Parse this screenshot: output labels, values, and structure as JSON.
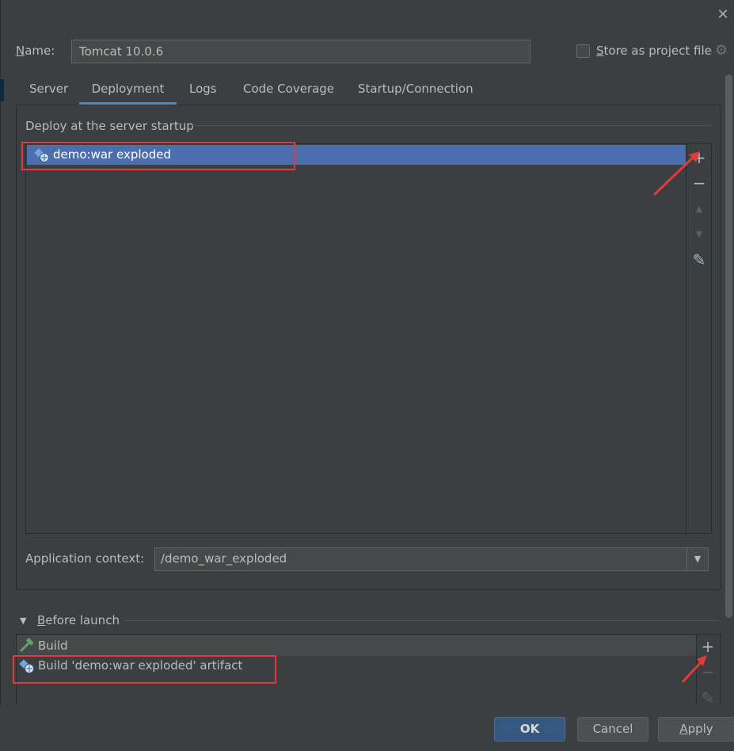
{
  "header": {
    "name_label_mnemonic": "N",
    "name_label_rest": "ame:",
    "name_value": "Tomcat 10.0.6",
    "store_label_mnemonic": "S",
    "store_label_rest": "tore as project file",
    "store_checked": false
  },
  "tabs": [
    {
      "label": "Server"
    },
    {
      "label": "Deployment",
      "active": true
    },
    {
      "label": "Logs"
    },
    {
      "label": "Code Coverage"
    },
    {
      "label": "Startup/Connection"
    }
  ],
  "deployment": {
    "section_title": "Deploy at the server startup",
    "artifacts": [
      {
        "label": "demo:war exploded",
        "icon": "war-artifact-icon",
        "selected": true
      }
    ],
    "toolbar": {
      "add": "+",
      "remove": "−",
      "up": "▲",
      "down": "▼",
      "edit": "✎"
    },
    "context_label": "Application context:",
    "context_value": "/demo_war_exploded"
  },
  "before_launch": {
    "title_mnemonic": "B",
    "title_rest": "efore launch",
    "items": [
      {
        "label": "Build",
        "icon": "hammer-icon"
      },
      {
        "label": "Build 'demo:war exploded' artifact",
        "icon": "war-artifact-icon"
      }
    ],
    "toolbar": {
      "add": "+",
      "remove": "−",
      "edit": "✎"
    }
  },
  "buttons": {
    "ok": "OK",
    "cancel": "Cancel",
    "apply_mnemonic": "A",
    "apply_rest": "pply"
  },
  "colors": {
    "background": "#3c3f41",
    "selection": "#4b6eaf",
    "annotation_red": "#e03c3c",
    "ok_button": "#365880"
  }
}
